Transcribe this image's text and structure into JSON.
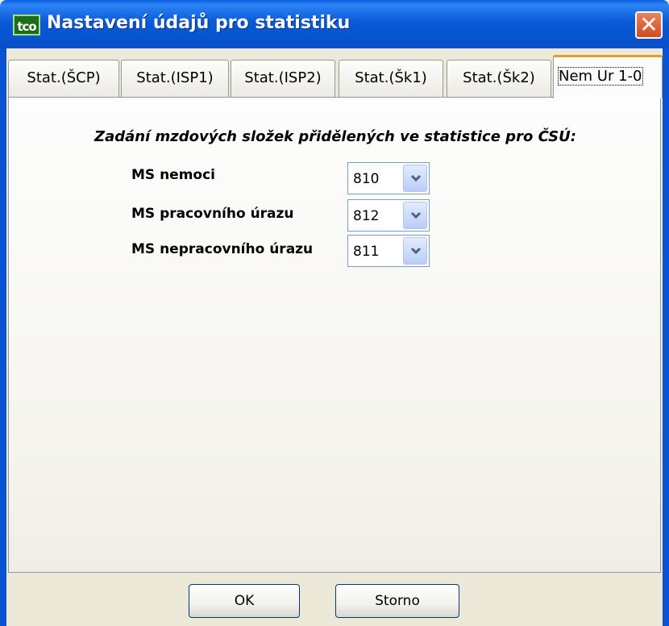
{
  "window": {
    "title": "Nastavení údajů pro statistiku",
    "app_icon_text": "tco",
    "close_glyph": "✕"
  },
  "tabs": [
    {
      "label": "Stat.(ŠCP)",
      "active": false
    },
    {
      "label": "Stat.(ISP1)",
      "active": false
    },
    {
      "label": "Stat.(ISP2)",
      "active": false
    },
    {
      "label": "Stat.(Šk1)",
      "active": false
    },
    {
      "label": "Stat.(Šk2)",
      "active": false
    },
    {
      "label": "Nem Ur 1-0",
      "active": true
    }
  ],
  "panel": {
    "heading": "Zadání mzdových složek přidělených ve statistice pro ČSÚ:",
    "rows": [
      {
        "label": "MS nemoci",
        "value": "810"
      },
      {
        "label": "MS pracovního úrazu",
        "value": "812"
      },
      {
        "label": "MS nepracovního úrazu",
        "value": "811"
      }
    ]
  },
  "buttons": {
    "ok": "OK",
    "cancel": "Storno"
  },
  "colors": {
    "titlebar": "#0a5ad8",
    "active_tab_accent": "#e69b22",
    "close_button": "#d24a22"
  }
}
